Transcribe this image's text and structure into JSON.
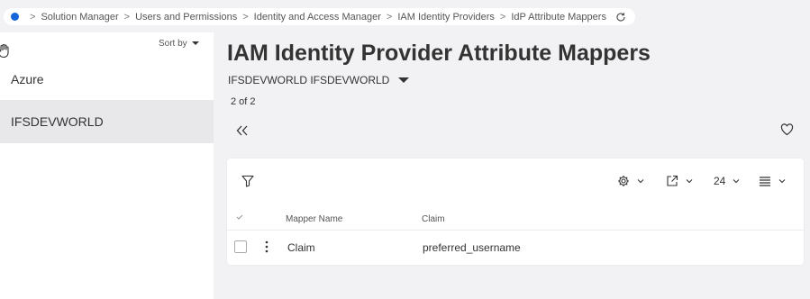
{
  "breadcrumb": {
    "items": [
      "Solution Manager",
      "Users and Permissions",
      "Identity and Access Manager",
      "IAM Identity Providers",
      "IdP Attribute Mappers"
    ]
  },
  "sidebar": {
    "sort_label": "Sort by",
    "items": [
      {
        "label": "Azure",
        "selected": false
      },
      {
        "label": "IFSDEVWORLD",
        "selected": true
      }
    ]
  },
  "main": {
    "title": "IAM Identity Provider Attribute Mappers",
    "context": "IFSDEVWORLD IFSDEVWORLD",
    "record_count": "2 of 2"
  },
  "table": {
    "toolbar": {
      "page_size": "24"
    },
    "columns": [
      "Mapper Name",
      "Claim"
    ],
    "rows": [
      {
        "mapper_name": "Claim",
        "claim": "preferred_username"
      }
    ]
  },
  "colors": {
    "accent": "#1565d8",
    "background": "#f2f2f4",
    "selected_item": "#e8e8ea"
  },
  "icons": {
    "home": "home-dot-icon",
    "refresh": "refresh-icon",
    "filter": "filter-icon",
    "settings": "gear-icon",
    "export": "export-icon",
    "view": "list-view-icon",
    "favorite": "heart-icon",
    "collapse": "double-chevron-left-icon"
  }
}
